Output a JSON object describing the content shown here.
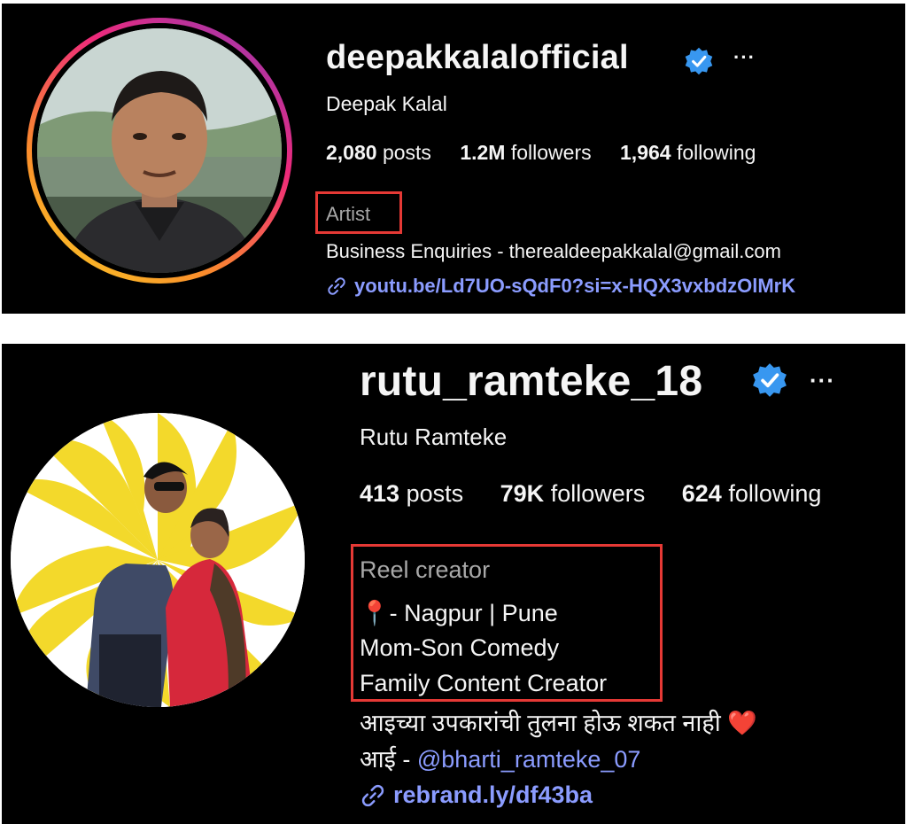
{
  "profiles": [
    {
      "username": "deepakkalalofficial",
      "full_name": "Deepak Kalal",
      "stats": {
        "posts_count": "2,080",
        "posts_label": "posts",
        "followers_count": "1.2M",
        "followers_label": "followers",
        "following_count": "1,964",
        "following_label": "following"
      },
      "category": "Artist",
      "bio_lines": [
        "Business Enquiries - therealdeepakkalal@gmail.com"
      ],
      "link": "youtu.be/Ld7UO-sQdF0?si=x-HQX3vxbdzOlMrK",
      "more_label": "···"
    },
    {
      "username": "rutu_ramteke_18",
      "full_name": "Rutu Ramteke",
      "stats": {
        "posts_count": "413",
        "posts_label": "posts",
        "followers_count": "79K",
        "followers_label": "followers",
        "following_count": "624",
        "following_label": "following"
      },
      "category": "Reel creator",
      "bio_lines": [
        "📍- Nagpur | Pune",
        "Mom-Son Comedy",
        "Family Content Creator",
        "आइच्या उपकारांची तुलना होऊ शकत नाही ❤️"
      ],
      "bio_mention_prefix": "आई - ",
      "bio_mention": "@bharti_ramteke_07",
      "link": "rebrand.ly/df43ba",
      "more_label": "···"
    }
  ],
  "colors": {
    "background": "#000000",
    "text": "#f5f5f5",
    "category_gray": "#a8a8a8",
    "link_blue": "#8b9cff",
    "verified_blue": "#3897f0",
    "highlight_red": "#e53935"
  },
  "icons": [
    "verified-badge-icon",
    "more-options-icon",
    "link-icon",
    "location-pin-icon",
    "heart-icon"
  ]
}
